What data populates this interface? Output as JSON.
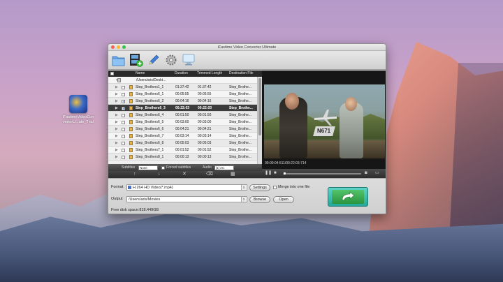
{
  "desktop": {
    "icon_label": "iFastimeVideoCon\nverterU...ate_Trial"
  },
  "window": {
    "title": "iFastime Video Converter Ultimate"
  },
  "toolbar": {
    "buttons": [
      {
        "name": "add-folder",
        "icon": "folder-icon"
      },
      {
        "name": "add-video",
        "icon": "film-add-icon"
      },
      {
        "name": "edit",
        "icon": "pencil-icon"
      },
      {
        "name": "settings",
        "icon": "gear-icon"
      },
      {
        "name": "screen",
        "icon": "monitor-icon"
      }
    ]
  },
  "file_list": {
    "columns": {
      "name": "Name",
      "duration": "Duration",
      "trimmed": "Trimmed Length",
      "destination": "Destination File"
    },
    "root": "/Users/aris/Deskt...",
    "rows": [
      {
        "name": "Step_Brothers1_1",
        "duration": "01:37:42",
        "trimmed": "01:37:42",
        "dest": "Step_Brothe...",
        "checked": false,
        "selected": false
      },
      {
        "name": "Step_Brothers6_1",
        "duration": "00:05:55",
        "trimmed": "00:05:55",
        "dest": "Step_Brothe...",
        "checked": false,
        "selected": false
      },
      {
        "name": "Step_Brothers6_2",
        "duration": "00:04:16",
        "trimmed": "00:04:16",
        "dest": "Step_Brothe...",
        "checked": true,
        "selected": false
      },
      {
        "name": "Step_Brothers6_3",
        "duration": "00:22:03",
        "trimmed": "00:22:03",
        "dest": "Step_Brothe...",
        "checked": true,
        "selected": true
      },
      {
        "name": "Step_Brothers6_4",
        "duration": "00:01:50",
        "trimmed": "00:01:50",
        "dest": "Step_Brothe...",
        "checked": false,
        "selected": false
      },
      {
        "name": "Step_Brothers6_5",
        "duration": "00:03:00",
        "trimmed": "00:03:00",
        "dest": "Step_Brothe...",
        "checked": false,
        "selected": false
      },
      {
        "name": "Step_Brothers6_6",
        "duration": "00:04:21",
        "trimmed": "00:04:21",
        "dest": "Step_Brothe...",
        "checked": false,
        "selected": false
      },
      {
        "name": "Step_Brothers6_7",
        "duration": "00:03:14",
        "trimmed": "00:03:14",
        "dest": "Step_Brothe...",
        "checked": false,
        "selected": false
      },
      {
        "name": "Step_Brothers6_8",
        "duration": "00:05:03",
        "trimmed": "00:05:03",
        "dest": "Step_Brothe...",
        "checked": false,
        "selected": false
      },
      {
        "name": "Step_Brothers7_1",
        "duration": "00:01:52",
        "trimmed": "00:01:52",
        "dest": "Step_Brothe...",
        "checked": false,
        "selected": false
      },
      {
        "name": "Step_Brothers8_1",
        "duration": "00:00:13",
        "trimmed": "00:00:13",
        "dest": "Step_Brothe...",
        "checked": false,
        "selected": false
      }
    ],
    "subtitles_label": "Subtitles",
    "subtitles_value": "None",
    "forced_subtitles_label": "Forced subtitles",
    "audio_label": "Audio",
    "audio_value": "[1] AC"
  },
  "preview": {
    "timecode": "00:00:04:511/00:22:03:714",
    "video_text": "N671",
    "progress": 0.02
  },
  "bottom": {
    "format_label": "Format",
    "format_value": "H.264 HD Video(*.mp4)",
    "settings_button": "Settings",
    "merge_label": "Merge into one file",
    "output_label": "Output",
    "output_value": "/Users/aris/Movies",
    "browse_button": "Browse",
    "open_button": "Open",
    "free_space": "Free disk space:818.449GB"
  }
}
